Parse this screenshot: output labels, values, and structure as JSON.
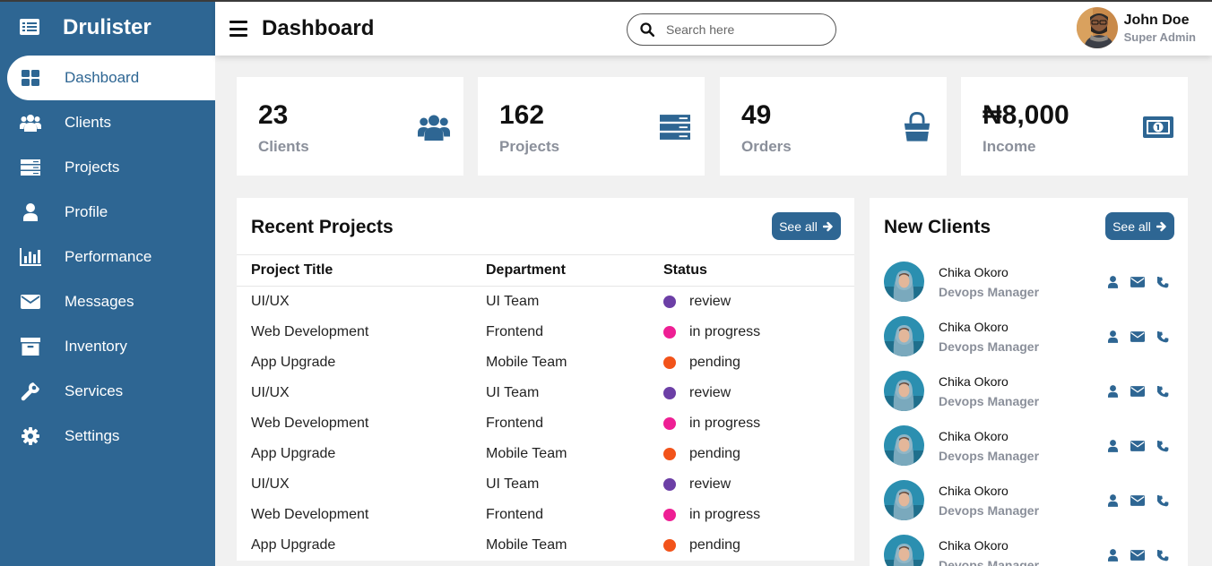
{
  "brand": {
    "name": "Drulister"
  },
  "colors": {
    "primary": "#2e6693",
    "review": "#6c3fa6",
    "in_progress": "#ee1f94",
    "pending": "#f2531a"
  },
  "sidebar": {
    "items": [
      {
        "label": "Dashboard",
        "icon": "dashboard-icon",
        "active": true
      },
      {
        "label": "Clients",
        "icon": "users-icon"
      },
      {
        "label": "Projects",
        "icon": "server-icon"
      },
      {
        "label": "Profile",
        "icon": "user-icon"
      },
      {
        "label": "Performance",
        "icon": "bar-chart-icon"
      },
      {
        "label": "Messages",
        "icon": "envelope-icon"
      },
      {
        "label": "Inventory",
        "icon": "archive-icon"
      },
      {
        "label": "Services",
        "icon": "wrench-icon"
      },
      {
        "label": "Settings",
        "icon": "gear-icon"
      }
    ]
  },
  "header": {
    "title": "Dashboard",
    "search_placeholder": "Search here",
    "user": {
      "name": "John Doe",
      "role": "Super Admin"
    }
  },
  "stats": [
    {
      "value": "23",
      "label": "Clients",
      "icon": "users-icon"
    },
    {
      "value": "162",
      "label": "Projects",
      "icon": "server-icon"
    },
    {
      "value": "49",
      "label": "Orders",
      "icon": "shopping-bag-icon"
    },
    {
      "value": "₦8,000",
      "label": "Income",
      "icon": "money-bill-icon"
    }
  ],
  "recent_projects": {
    "title": "Recent Projects",
    "see_all": "See all",
    "columns": [
      "Project Title",
      "Department",
      "Status"
    ],
    "rows": [
      {
        "title": "UI/UX",
        "department": "UI Team",
        "status": "review"
      },
      {
        "title": "Web Development",
        "department": "Frontend",
        "status": "in progress"
      },
      {
        "title": "App Upgrade",
        "department": "Mobile Team",
        "status": "pending"
      },
      {
        "title": "UI/UX",
        "department": "UI Team",
        "status": "review"
      },
      {
        "title": "Web Development",
        "department": "Frontend",
        "status": "in progress"
      },
      {
        "title": "App Upgrade",
        "department": "Mobile Team",
        "status": "pending"
      },
      {
        "title": "UI/UX",
        "department": "UI Team",
        "status": "review"
      },
      {
        "title": "Web Development",
        "department": "Frontend",
        "status": "in progress"
      },
      {
        "title": "App Upgrade",
        "department": "Mobile Team",
        "status": "pending"
      }
    ]
  },
  "new_clients": {
    "title": "New Clients",
    "see_all": "See all",
    "items": [
      {
        "name": "Chika Okoro",
        "role": "Devops Manager"
      },
      {
        "name": "Chika Okoro",
        "role": "Devops Manager"
      },
      {
        "name": "Chika Okoro",
        "role": "Devops Manager"
      },
      {
        "name": "Chika Okoro",
        "role": "Devops Manager"
      },
      {
        "name": "Chika Okoro",
        "role": "Devops Manager"
      },
      {
        "name": "Chika Okoro",
        "role": "Devops Manager"
      }
    ]
  }
}
